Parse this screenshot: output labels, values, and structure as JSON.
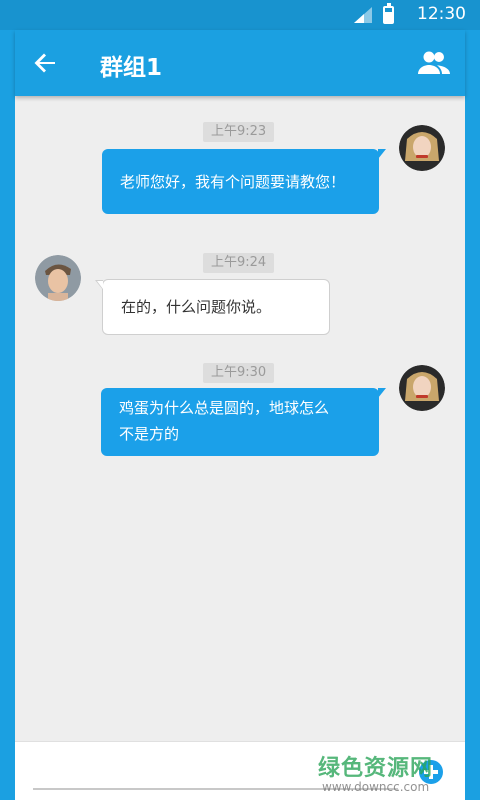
{
  "status_bar": {
    "time": "12:30"
  },
  "app_bar": {
    "title": "群组1"
  },
  "messages": [
    {
      "time": "上午9:23",
      "text_lines": [
        "老师您好，我有个问题要请教您！"
      ],
      "direction": "outgoing"
    },
    {
      "time": "上午9:24",
      "text_lines": [
        "在的，什么问题你说。"
      ],
      "direction": "incoming"
    },
    {
      "time": "上午9:30",
      "text_lines": [
        "鸡蛋为什么总是圆的，地球怎么",
        "不是方的"
      ],
      "direction": "outgoing"
    }
  ],
  "input": {
    "value": "",
    "placeholder": ""
  },
  "watermark": {
    "text": "绿色资源网",
    "url": "www.downcc.com"
  },
  "colors": {
    "accent": "#1ba0e1",
    "outgoing_bubble": "#1ba0e9",
    "background": "#eeeeee"
  }
}
